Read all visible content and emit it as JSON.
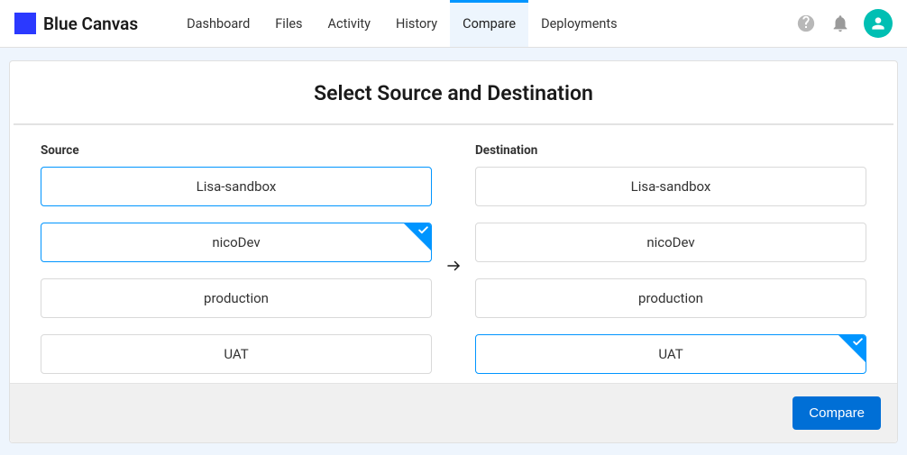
{
  "brand": "Blue Canvas",
  "nav": {
    "items": [
      {
        "label": "Dashboard",
        "active": false
      },
      {
        "label": "Files",
        "active": false
      },
      {
        "label": "Activity",
        "active": false
      },
      {
        "label": "History",
        "active": false
      },
      {
        "label": "Compare",
        "active": true
      },
      {
        "label": "Deployments",
        "active": false
      }
    ]
  },
  "page": {
    "title": "Select Source and Destination",
    "source_label": "Source",
    "destination_label": "Destination",
    "compare_button": "Compare"
  },
  "source": {
    "items": [
      {
        "label": "Lisa-sandbox",
        "highlight": true,
        "selected": false
      },
      {
        "label": "nicoDev",
        "highlight": true,
        "selected": true
      },
      {
        "label": "production",
        "highlight": false,
        "selected": false
      },
      {
        "label": "UAT",
        "highlight": false,
        "selected": false
      }
    ]
  },
  "destination": {
    "items": [
      {
        "label": "Lisa-sandbox",
        "highlight": false,
        "selected": false
      },
      {
        "label": "nicoDev",
        "highlight": false,
        "selected": false
      },
      {
        "label": "production",
        "highlight": false,
        "selected": false
      },
      {
        "label": "UAT",
        "highlight": true,
        "selected": true
      }
    ]
  }
}
